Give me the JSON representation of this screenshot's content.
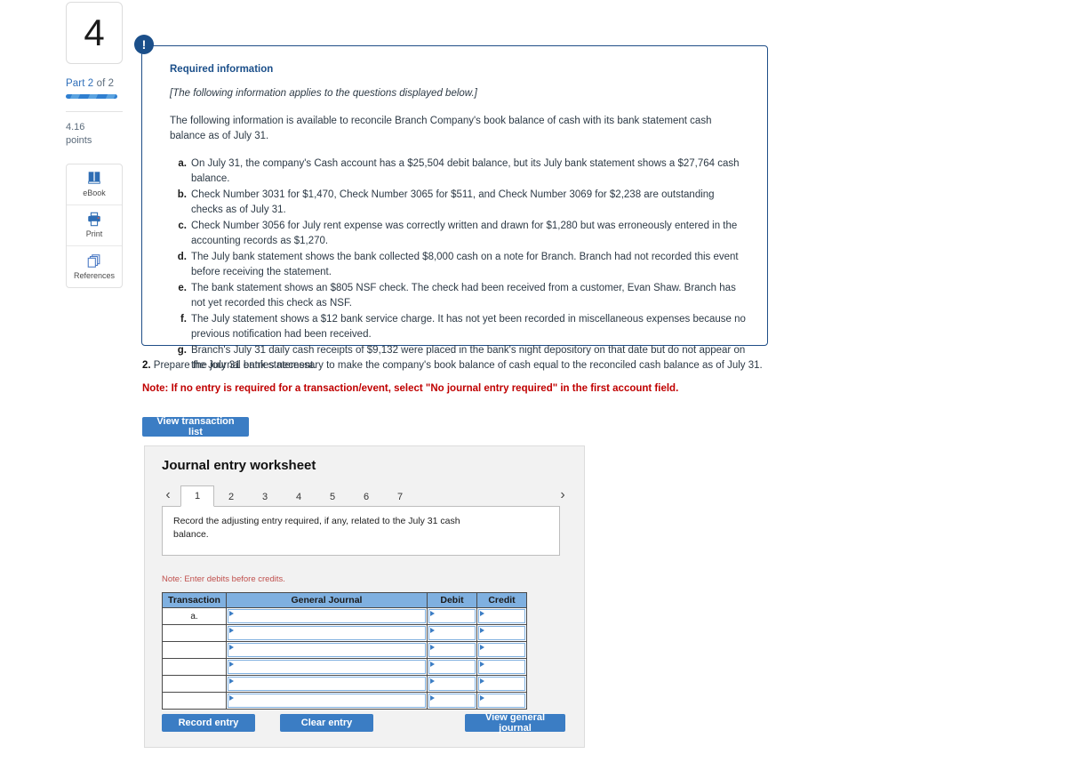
{
  "sidebar": {
    "question_number": "4",
    "part_label": "Part 2",
    "part_of": " of 2",
    "points_value": "4.16",
    "points_unit": "points",
    "tools": [
      {
        "id": "ebook",
        "label": "eBook",
        "icon": "book-icon"
      },
      {
        "id": "print",
        "label": "Print",
        "icon": "printer-icon"
      },
      {
        "id": "references",
        "label": "References",
        "icon": "copy-icon"
      }
    ]
  },
  "required_info": {
    "badge": "!",
    "title": "Required information",
    "applies_note": "[The following information applies to the questions displayed below.]",
    "intro": "The following information is available to reconcile Branch Company's book balance of cash with its bank statement cash balance as of July 31.",
    "items": [
      {
        "marker": "a.",
        "text": "On July 31, the company's Cash account has a $25,504 debit balance, but its July bank statement shows a $27,764 cash balance."
      },
      {
        "marker": "b.",
        "text": "Check Number 3031 for $1,470, Check Number 3065 for $511, and Check Number 3069 for $2,238 are outstanding checks as of July 31."
      },
      {
        "marker": "c.",
        "text": "Check Number 3056 for July rent expense was correctly written and drawn for $1,280 but was erroneously entered in the accounting records as $1,270."
      },
      {
        "marker": "d.",
        "text": "The July bank statement shows the bank collected $8,000 cash on a note for Branch. Branch had not recorded this event before receiving the statement."
      },
      {
        "marker": "e.",
        "text": "The bank statement shows an $805 NSF check. The check had been received from a customer, Evan Shaw. Branch has not yet recorded this check as NSF."
      },
      {
        "marker": "f.",
        "text": "The July statement shows a $12 bank service charge. It has not yet been recorded in miscellaneous expenses because no previous notification had been received."
      },
      {
        "marker": "g.",
        "text": "Branch's July 31 daily cash receipts of $9,132 were placed in the bank's night depository on that date but do not appear on the July 31 bank statement."
      }
    ]
  },
  "question": {
    "number": "2.",
    "text": " Prepare the journal entries necessary to make the company's book balance of cash equal to the reconciled cash balance as of July 31.",
    "note": "Note: If no entry is required for a transaction/event, select \"No journal entry required\" in the first account field.",
    "view_transaction_list_label": "View transaction list"
  },
  "worksheet": {
    "title": "Journal entry worksheet",
    "prev_arrow": "‹",
    "next_arrow": "›",
    "tabs": [
      "1",
      "2",
      "3",
      "4",
      "5",
      "6",
      "7"
    ],
    "active_tab": "1",
    "instruction": "Record the adjusting entry required, if any, related to the July 31 cash balance.",
    "debits_note": "Note: Enter debits before credits.",
    "table": {
      "headers": [
        "Transaction",
        "General Journal",
        "Debit",
        "Credit"
      ],
      "rows": [
        {
          "transaction": "a.",
          "general_journal": "",
          "debit": "",
          "credit": ""
        },
        {
          "transaction": "",
          "general_journal": "",
          "debit": "",
          "credit": ""
        },
        {
          "transaction": "",
          "general_journal": "",
          "debit": "",
          "credit": ""
        },
        {
          "transaction": "",
          "general_journal": "",
          "debit": "",
          "credit": ""
        },
        {
          "transaction": "",
          "general_journal": "",
          "debit": "",
          "credit": ""
        },
        {
          "transaction": "",
          "general_journal": "",
          "debit": "",
          "credit": ""
        }
      ]
    },
    "buttons": {
      "record": "Record entry",
      "clear": "Clear entry",
      "view_general_journal": "View general journal"
    }
  },
  "colors": {
    "accent_blue": "#3b7dc4",
    "navy": "#1b4f8a",
    "header_blue": "#7fb0e0",
    "red_note": "#c00000",
    "panel_bg": "#f2f2f2"
  }
}
